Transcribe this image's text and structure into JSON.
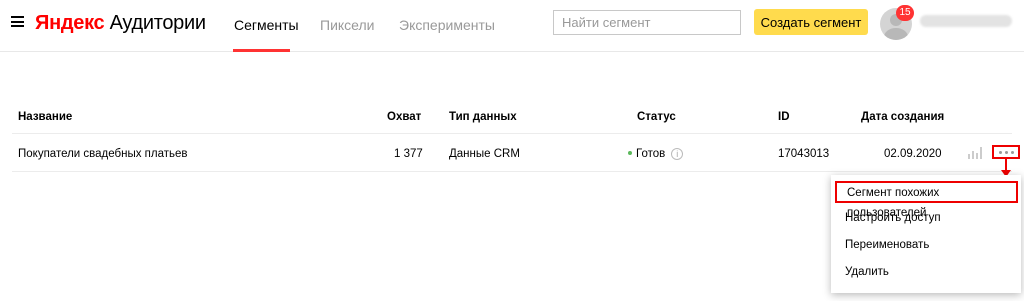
{
  "header": {
    "logo_brand": "Яндекс",
    "logo_product": "Аудитории",
    "tabs": [
      {
        "label": "Сегменты",
        "active": true
      },
      {
        "label": "Пиксели",
        "active": false
      },
      {
        "label": "Эксперименты",
        "active": false
      }
    ],
    "search_placeholder": "Найти сегмент",
    "create_label": "Создать сегмент",
    "notification_count": "15"
  },
  "table": {
    "columns": [
      "Название",
      "Охват",
      "Тип данных",
      "Статус",
      "ID",
      "Дата создания"
    ],
    "rows": [
      {
        "name": "Покупатели свадебных платьев",
        "reach": "1 377",
        "data_type": "Данные CRM",
        "status": "Готов",
        "id": "17043013",
        "created": "02.09.2020"
      }
    ]
  },
  "menu": {
    "items": [
      {
        "label": "Сегмент похожих пользователей"
      },
      {
        "label": "Настроить доступ"
      },
      {
        "label": "Переименовать"
      },
      {
        "label": "Удалить"
      }
    ]
  },
  "colors": {
    "brand_red": "#ff0000",
    "accent_yellow": "#ffdb4d",
    "tab_underline": "#ff3333",
    "status_green": "#5cb85c",
    "annotation_red": "#ee0000"
  }
}
